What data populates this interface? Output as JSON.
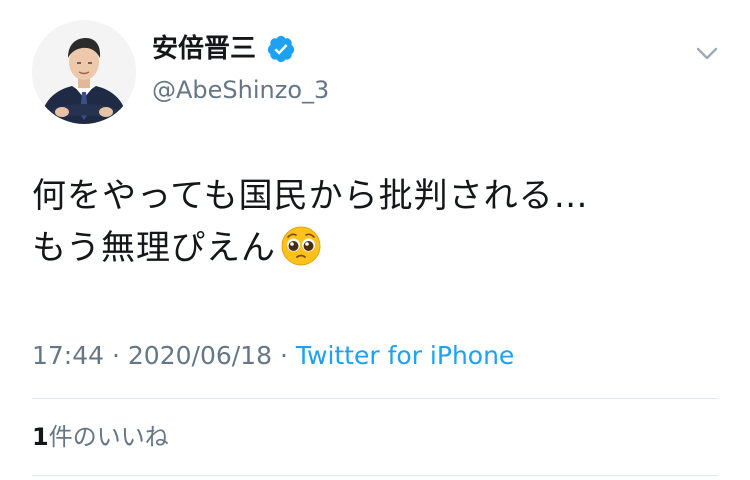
{
  "user": {
    "display_name": "安倍晋三",
    "handle": "@AbeShinzo_3",
    "verified": true
  },
  "tweet": {
    "line1": "何をやっても国民から批判される…",
    "line2": "もう無理ぴえん",
    "emoji": "pleading-face-emoji",
    "time": "17:44",
    "separator": "·",
    "date": "2020/06/18",
    "source": "Twitter for iPhone"
  },
  "likes": {
    "count": "1",
    "label": "件のいいね"
  },
  "colors": {
    "text": "#14171a",
    "secondary": "#657786",
    "link": "#1da1f2",
    "divider": "#e1e8ed",
    "verified": "#1da1f2"
  },
  "icons": {
    "verified": "verified-badge-icon",
    "menu": "chevron-down-icon"
  }
}
